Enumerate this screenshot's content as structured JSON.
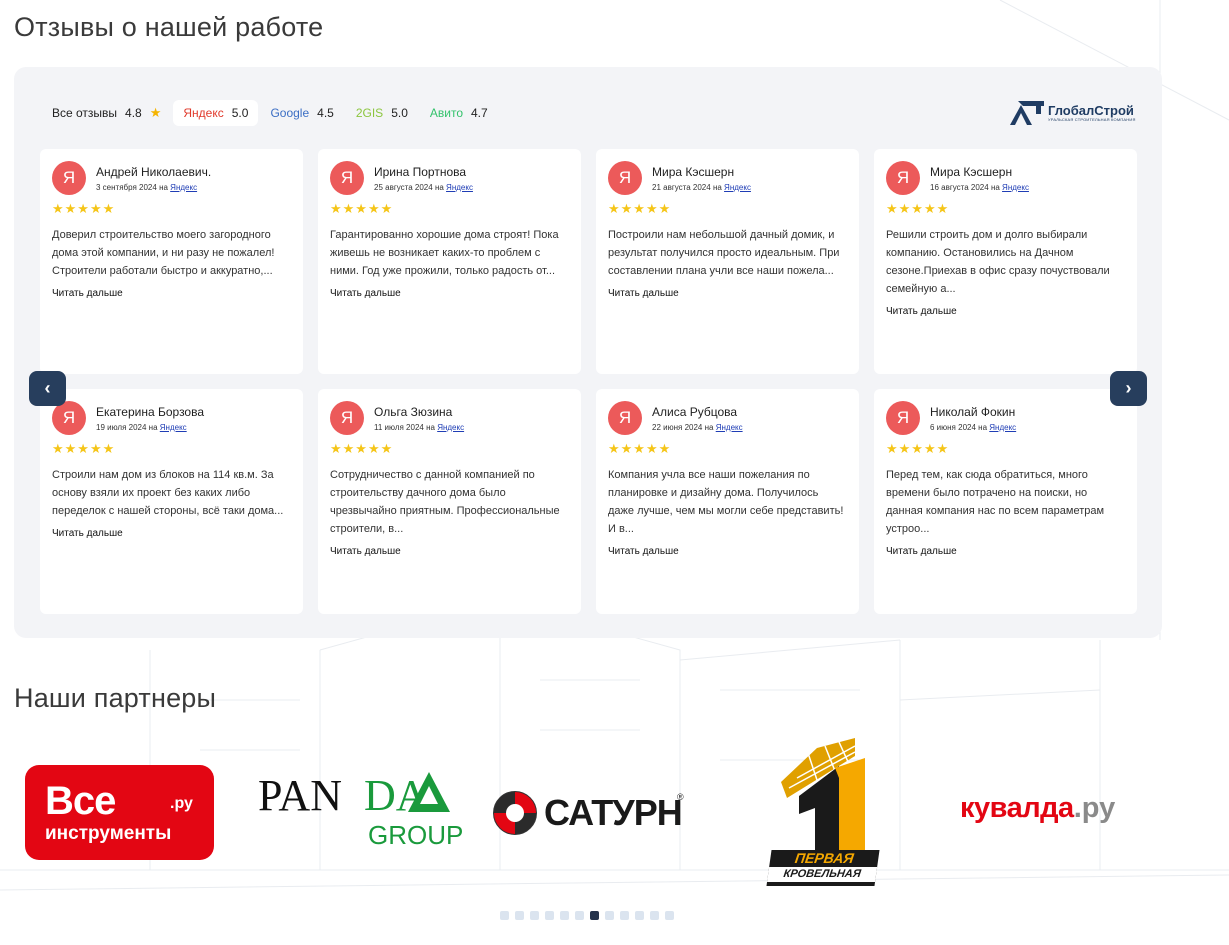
{
  "reviews_section": {
    "title": "Отзывы о нашей работе",
    "ratings": [
      {
        "label": "Все отзывы",
        "value": "4.8",
        "color": "#222222",
        "active": false,
        "star": true
      },
      {
        "label": "Яндекс",
        "value": "5.0",
        "color": "#e0392b",
        "active": true,
        "star": false
      },
      {
        "label": "Google",
        "value": "4.5",
        "color": "#3b6ec4",
        "active": false,
        "star": false
      },
      {
        "label": "2GIS",
        "value": "5.0",
        "color": "#8cc63f",
        "active": false,
        "star": false
      },
      {
        "label": "Авито",
        "value": "4.7",
        "color": "#32c26b",
        "active": false,
        "star": false
      }
    ],
    "brand": {
      "name": "ГлобалСтрой",
      "tagline": "УРАЛЬСКАЯ СТРОИТЕЛЬНАЯ КОМПАНИЯ"
    },
    "reviews": [
      {
        "avatar": "Я",
        "author": "Андрей Николаевич.",
        "date": "3 сентября 2024",
        "on": "на",
        "source": "Яндекс",
        "stars": "★★★★★",
        "text": "Доверил строительство моего загородного дома этой компании, и ни разу не пожалел! Строители работали быстро и аккуратно,...",
        "more": "Читать дальше"
      },
      {
        "avatar": "Я",
        "author": "Ирина Портнова",
        "date": "25 августа 2024",
        "on": "на",
        "source": "Яндекс",
        "stars": "★★★★★",
        "text": "Гарантированно хорошие дома строят! Пока живешь не возникает каких-то проблем с ними. Год уже прожили, только радость от...",
        "more": "Читать дальше"
      },
      {
        "avatar": "Я",
        "author": "Мира Кэсшерн",
        "date": "21 августа 2024",
        "on": "на",
        "source": "Яндекс",
        "stars": "★★★★★",
        "text": "Построили нам небольшой дачный домик, и результат получился просто идеальным. При составлении плана учли все наши пожела...",
        "more": "Читать дальше"
      },
      {
        "avatar": "Я",
        "author": "Мира Кэсшерн",
        "date": "16 августа 2024",
        "on": "на",
        "source": "Яндекс",
        "stars": "★★★★★",
        "text": "Решили строить дом и долго выбирали компанию. Остановились на Дачном сезоне.Приехав в офис сразу почуствовали семейную а...",
        "more": "Читать дальше"
      },
      {
        "avatar": "Я",
        "author": "Екатерина Борзова",
        "date": "19 июля 2024",
        "on": "на",
        "source": "Яндекс",
        "stars": "★★★★★",
        "text": "Строили нам дом из блоков на 114 кв.м. За основу взяли их проект без каких либо переделок с нашей стороны, всё таки дома...",
        "more": "Читать дальше"
      },
      {
        "avatar": "Я",
        "author": "Ольга Зюзина",
        "date": "11 июля 2024",
        "on": "на",
        "source": "Яндекс",
        "stars": "★★★★★",
        "text": "Сотрудничество с данной компанией по строительству дачного дома было чрезвычайно приятным. Профессиональные строители, в...",
        "more": "Читать дальше"
      },
      {
        "avatar": "Я",
        "author": "Алиса Рубцова",
        "date": "22 июня 2024",
        "on": "на",
        "source": "Яндекс",
        "stars": "★★★★★",
        "text": "Компания учла все наши пожелания по планировке и дизайну дома. Получилось даже лучше, чем мы могли себе представить! И в...",
        "more": "Читать дальше"
      },
      {
        "avatar": "Я",
        "author": "Николай Фокин",
        "date": "6 июня 2024",
        "on": "на",
        "source": "Яндекс",
        "stars": "★★★★★",
        "text": "Перед тем, как сюда обратиться, много времени было потрачено на поиски, но данная компания нас по всем параметрам устроо...",
        "more": "Читать дальше"
      }
    ],
    "arrows": {
      "prev": "‹",
      "next": "›"
    }
  },
  "partners_section": {
    "title": "Наши партнеры",
    "partners": [
      {
        "name": "Все инструменты.ру",
        "line1": "Все",
        "line2": "инструменты",
        "suffix": ".ру",
        "color": "#e30613"
      },
      {
        "name": "PANDA GROUP",
        "word1": "PAN",
        "word2": "DA",
        "word3": "GROUP",
        "color": "#1a9a3c"
      },
      {
        "name": "САТУРН",
        "word": "САТУРН",
        "mark": "®"
      },
      {
        "name": "Первая Кровельная",
        "line1": "ПЕРВАЯ",
        "line2": "КРОВЕЛЬНАЯ",
        "numeral": "1",
        "color": "#f5a800"
      },
      {
        "name": "кувалда.ру",
        "word": "кувалда",
        "suffix": ".ру",
        "color": "#e30613"
      }
    ],
    "pagination": {
      "count": 12,
      "active_index": 6
    }
  }
}
